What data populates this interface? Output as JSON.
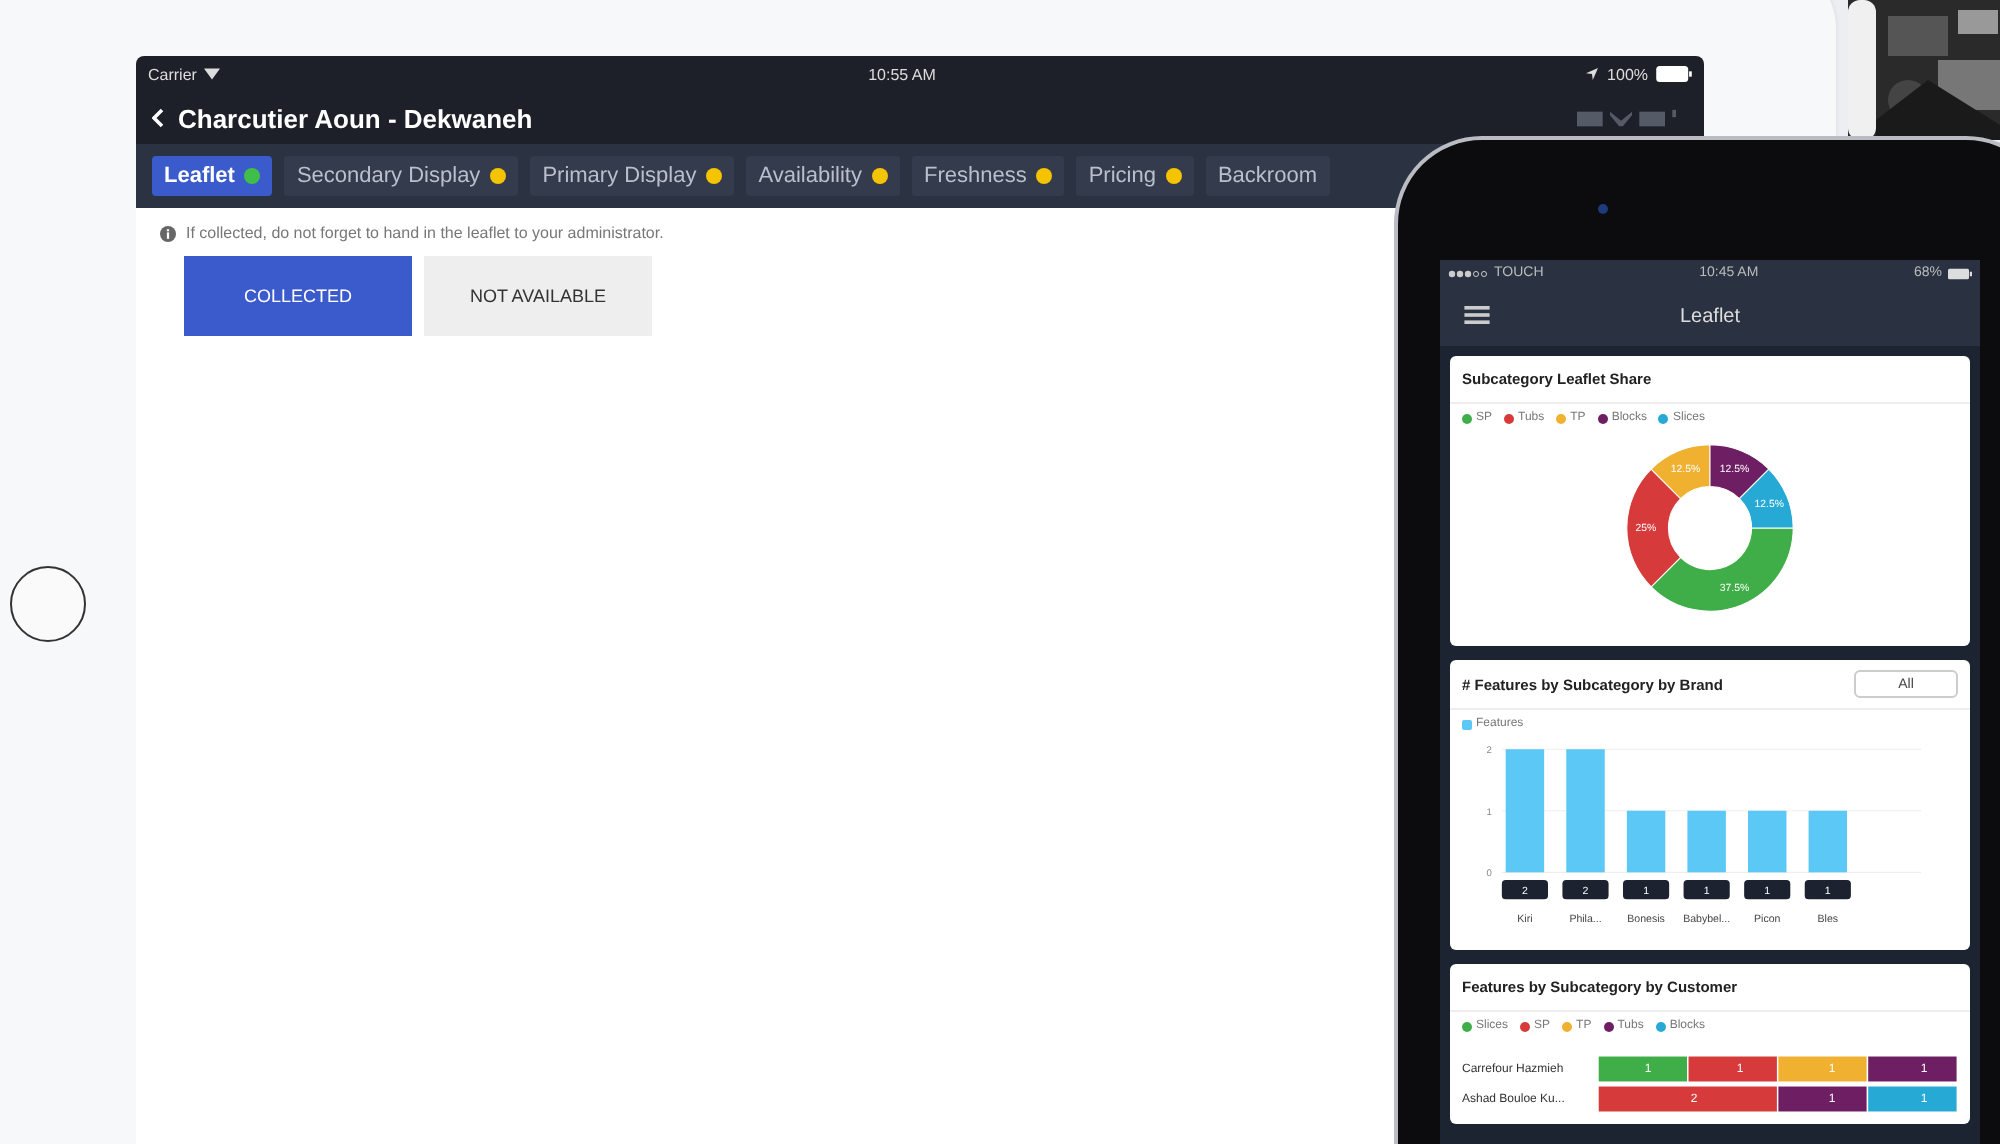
{
  "tablet": {
    "status_bar": {
      "carrier": "Carrier",
      "time": "10:55 AM",
      "battery": "100%"
    },
    "title": "Charcutier Aoun - Dekwaneh",
    "tabs": [
      {
        "label": "Leaflet",
        "selected": true,
        "color": "#3fbf4a"
      },
      {
        "label": "Secondary Display",
        "selected": false,
        "color": "#f5c400"
      },
      {
        "label": "Primary Display",
        "selected": false,
        "color": "#f5c400"
      },
      {
        "label": "Availability",
        "selected": false,
        "color": "#f5c400"
      },
      {
        "label": "Freshness",
        "selected": false,
        "color": "#f5c400"
      },
      {
        "label": "Pricing",
        "selected": false,
        "color": "#f5c400"
      },
      {
        "label": "Backroom",
        "selected": false
      }
    ],
    "note": "If collected, do not forget to hand in the leaflet to your administrator.",
    "buttons": [
      {
        "label": "COLLECTED",
        "selected": true
      },
      {
        "label": "NOT AVAILABLE",
        "selected": false
      }
    ]
  },
  "phone": {
    "status_bar": {
      "carrier": "TOUCH",
      "time": "10:45 AM",
      "battery": "68%"
    },
    "title": "Leaflet",
    "cards": [
      {
        "title": "Subcategory Leaflet Share",
        "chart_data": {
          "type": "donut",
          "categories": [
            "SP",
            "Tubs",
            "TP",
            "Blocks",
            "Slices"
          ],
          "values": [
            37.5,
            25,
            12.5,
            12.5,
            12.5
          ],
          "colors": [
            "#3fae49",
            "#d63a3a",
            "#f0b030",
            "#6e1f63",
            "#27a9d6"
          ],
          "value_labels": [
            "37.5%",
            "25%",
            "12.5%",
            "12.5%",
            "12.5%"
          ]
        }
      },
      {
        "title": "# Features by Subcategory by Brand",
        "filter": "All",
        "chart_data": {
          "type": "bar",
          "categories": [
            "Kiri",
            "Phila...",
            "Bonesis",
            "Babybel...",
            "Picon",
            "Bles"
          ],
          "series": [
            {
              "name": "Features",
              "color": "#5bc8f5",
              "values": [
                2,
                2,
                1,
                1,
                1,
                1
              ]
            }
          ],
          "yticks": [
            0,
            1,
            2
          ],
          "ylim": [
            0,
            2
          ],
          "data_labels": true
        }
      },
      {
        "title": "Features by Subcategory by Customer",
        "chart_data": {
          "type": "bar",
          "orientation": "horizontal",
          "stacked": true,
          "categories": [
            "Carrefour Hazmieh",
            "Ashad Bouloe Ku..."
          ],
          "series": [
            {
              "name": "Slices",
              "color": "#3fae49",
              "values": [
                1,
                null
              ]
            },
            {
              "name": "SP",
              "color": "#d63a3a",
              "values": [
                1,
                2
              ]
            },
            {
              "name": "TP",
              "color": "#f0b030",
              "values": [
                1,
                null
              ]
            },
            {
              "name": "Tubs",
              "color": "#6e1f63",
              "values": [
                1,
                1
              ]
            },
            {
              "name": "Blocks",
              "color": "#27a9d6",
              "values": [
                null,
                1
              ]
            }
          ],
          "xlim": [
            0,
            4
          ],
          "data_labels": true
        }
      }
    ]
  }
}
